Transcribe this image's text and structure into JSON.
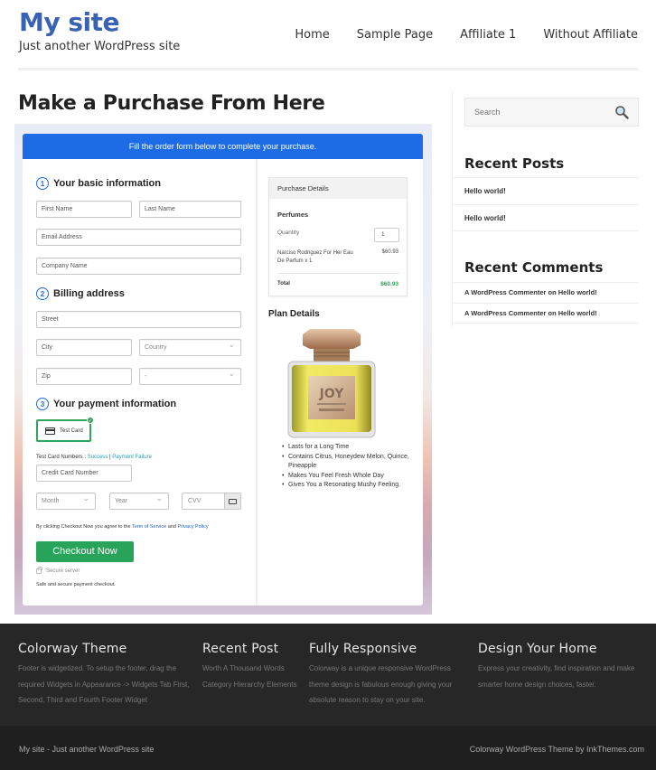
{
  "header": {
    "site_title": "My site",
    "tagline": "Just another WordPress site",
    "nav": [
      {
        "label": "Home"
      },
      {
        "label": "Sample Page"
      },
      {
        "label": "Affiliate 1"
      },
      {
        "label": "Without Affiliate"
      }
    ]
  },
  "main": {
    "page_title": "Make a Purchase From Here",
    "form": {
      "banner": "Fill the order form below to complete your purchase.",
      "sections": [
        {
          "num": "1",
          "title": "Your basic information"
        },
        {
          "num": "2",
          "title": "Billing address"
        },
        {
          "num": "3",
          "title": "Your payment information"
        }
      ],
      "fields": {
        "first_name": "First Name",
        "last_name": "Last Name",
        "email": "Email Address",
        "company": "Company Name",
        "street": "Street",
        "city": "City",
        "country": "Country",
        "zip": "Zip",
        "state": "-",
        "card_number": "Credit Card Number",
        "month": "Month",
        "year": "Year",
        "cvv": "CVV"
      },
      "payment_method": "Test Card",
      "test_numbers_label": "Test Card Numbers : ",
      "test_success": "Success",
      "test_separator": " | ",
      "test_failure": "Payment Failure",
      "agree_prefix": "By clicking Checkout Now you agree to the ",
      "terms_link": "Term of Service",
      "agree_and": " and ",
      "privacy_link": "Privacy Policy",
      "checkout_button": "Checkout Now",
      "secure_server": "Secure server",
      "safe_text": "Safe and secure payment checkout."
    },
    "purchase_details": {
      "heading": "Purchase Details",
      "product_group": "Perfumes",
      "quantity_label": "Quantity",
      "quantity_value": "1",
      "item_name": "Narciso Rodriguez For Her Eau De Parfum x 1",
      "item_price": "$60.93",
      "total_label": "Total",
      "total_value": "$60.93"
    },
    "plan_details": {
      "title": "Plan Details",
      "product_image_label": "JOY",
      "benefits": [
        "Lasts for a Long Time",
        "Contains Citrus, Honeydew Melon, Quince, Pineapple",
        "Makes You Feel Fresh Whole Day",
        "Gives You a Resonating Mushy Feeling."
      ]
    }
  },
  "sidebar": {
    "search_placeholder": "Search",
    "recent_posts_title": "Recent Posts",
    "recent_posts": [
      "Hello world!",
      "Hello world!"
    ],
    "recent_comments_title": "Recent Comments",
    "recent_comments": [
      "A WordPress Commenter on Hello world!",
      "A WordPress Commenter on Hello world!"
    ]
  },
  "footer": {
    "columns": [
      {
        "title": "Colorway Theme",
        "text": "Footer is widgetized. To setup the footer, drag the required Widgets in Appearance -> Widgets Tab First, Second, Third and Fourth Footer Widget"
      },
      {
        "title": "Recent Post",
        "text": "Worth A Thousand Words Category Hierarchy Elements"
      },
      {
        "title": "Fully Responsive",
        "text": "Colorway is a unique responsive WordPress theme design is fabulous enough giving your absolute reason to stay on your site."
      },
      {
        "title": "Design Your Home",
        "text": "Express your creativity, find inspiration and make smarter home design choices, faster."
      }
    ],
    "bottom_left": "My site - Just another WordPress site",
    "bottom_right": "Colorway WordPress Theme by InkThemes.com"
  },
  "colors": {
    "brand_blue": "#3a62b4",
    "banner_blue": "#1e6be6",
    "checkout_green": "#27a35a",
    "total_green": "#2fa55a",
    "footer_dark": "#272727"
  }
}
